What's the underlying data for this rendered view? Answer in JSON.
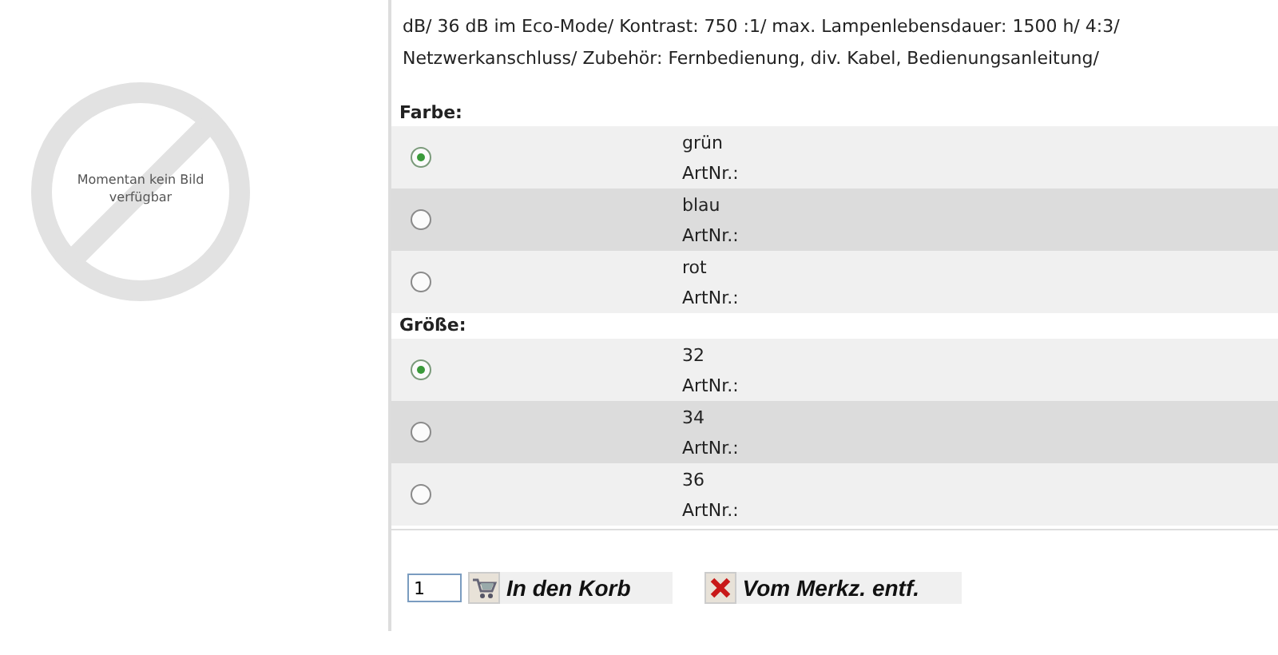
{
  "image_placeholder": {
    "text": "Momentan kein Bild verfügbar"
  },
  "description": [
    "dB/ 36 dB im Eco-Mode/ Kontrast: 750 :1/ max. Lampenlebensdauer: 1500 h/ 4:3/",
    "Netzwerkanschluss/ Zubehör: Fernbedienung, div. Kabel, Bedienungsanleitung/"
  ],
  "option_groups": [
    {
      "title": "Farbe:",
      "options": [
        {
          "value": "grün",
          "art_nr": "ArtNr.:",
          "selected": true
        },
        {
          "value": "blau",
          "art_nr": "ArtNr.:",
          "selected": false
        },
        {
          "value": "rot",
          "art_nr": "ArtNr.:",
          "selected": false
        }
      ]
    },
    {
      "title": "Größe:",
      "options": [
        {
          "value": "32",
          "art_nr": "ArtNr.:",
          "selected": true
        },
        {
          "value": "34",
          "art_nr": "ArtNr.:",
          "selected": false
        },
        {
          "value": "36",
          "art_nr": "ArtNr.:",
          "selected": false
        }
      ]
    }
  ],
  "quantity": "1",
  "buttons": [
    {
      "kind": "cart",
      "label": "In den Korb"
    },
    {
      "kind": "remove",
      "label": "Vom Merkz. entf."
    }
  ]
}
